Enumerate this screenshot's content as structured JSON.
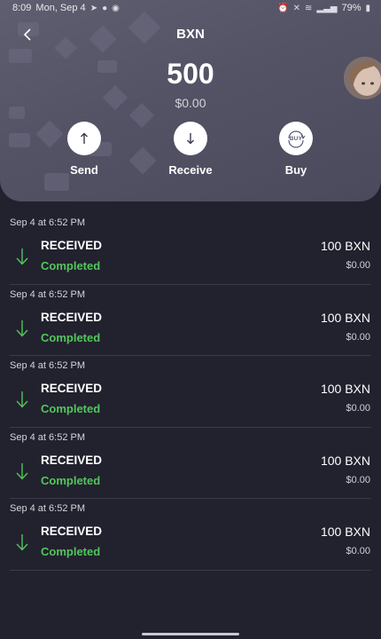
{
  "status_bar": {
    "time": "8:09",
    "date": "Mon, Sep 4",
    "battery": "79%"
  },
  "header": {
    "title": "BXN",
    "balance": "500",
    "fiat_balance": "$0.00"
  },
  "actions": [
    {
      "label": "Send",
      "icon": "arrow-up-icon"
    },
    {
      "label": "Receive",
      "icon": "arrow-down-icon"
    },
    {
      "label": "Buy",
      "icon": "buy-icon",
      "icon_text": "BUY"
    }
  ],
  "transactions": [
    {
      "date": "Sep 4 at 6:52 PM",
      "type": "RECEIVED",
      "status": "Completed",
      "amount": "100 BXN",
      "fiat": "$0.00"
    },
    {
      "date": "Sep 4 at 6:52 PM",
      "type": "RECEIVED",
      "status": "Completed",
      "amount": "100 BXN",
      "fiat": "$0.00"
    },
    {
      "date": "Sep 4 at 6:52 PM",
      "type": "RECEIVED",
      "status": "Completed",
      "amount": "100 BXN",
      "fiat": "$0.00"
    },
    {
      "date": "Sep 4 at 6:52 PM",
      "type": "RECEIVED",
      "status": "Completed",
      "amount": "100 BXN",
      "fiat": "$0.00"
    },
    {
      "date": "Sep 4 at 6:52 PM",
      "type": "RECEIVED",
      "status": "Completed",
      "amount": "100 BXN",
      "fiat": "$0.00"
    }
  ],
  "colors": {
    "background": "#22212e",
    "header": "#545366",
    "completed": "#52c65c"
  }
}
